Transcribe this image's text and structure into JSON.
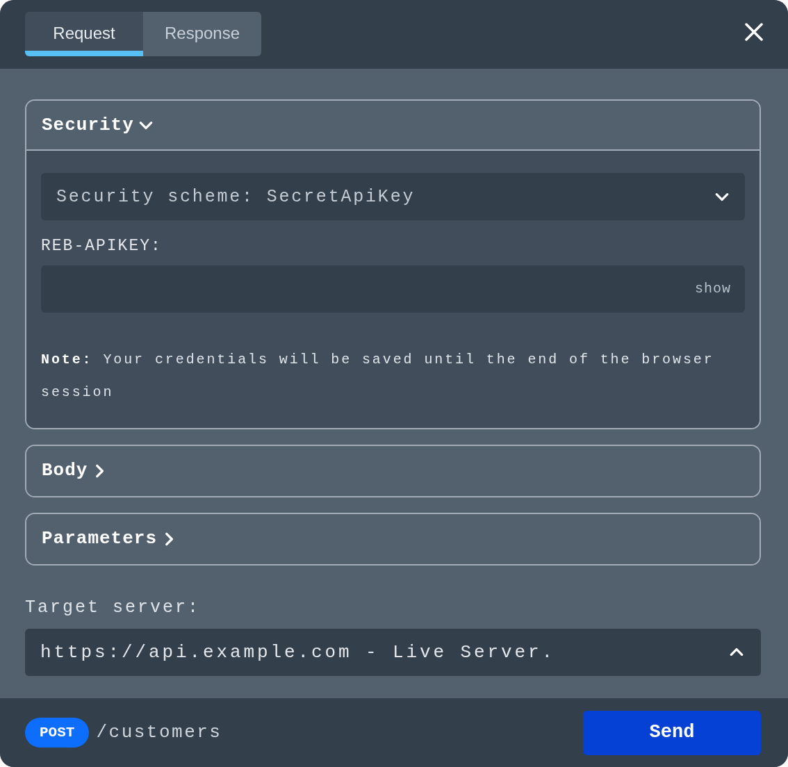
{
  "tabs": [
    {
      "label": "Request",
      "selected": true
    },
    {
      "label": "Response",
      "selected": false
    }
  ],
  "sections": [
    {
      "title": "Security",
      "expanded": true,
      "scheme": "Security scheme: SecretApiKey",
      "key_label": "REB-APIKEY:",
      "show": "show",
      "note": "**Note:** Your credentials will be saved until the end of the browser session"
    },
    {
      "title": "Body",
      "expanded": false
    },
    {
      "title": "Parameters",
      "expanded": false
    }
  ],
  "target": {
    "label": "Target server:",
    "value": "https://api.example.com - Live Server.",
    "open": true
  },
  "footer": {
    "method": "POST",
    "path": "/customers",
    "send": "Send"
  }
}
